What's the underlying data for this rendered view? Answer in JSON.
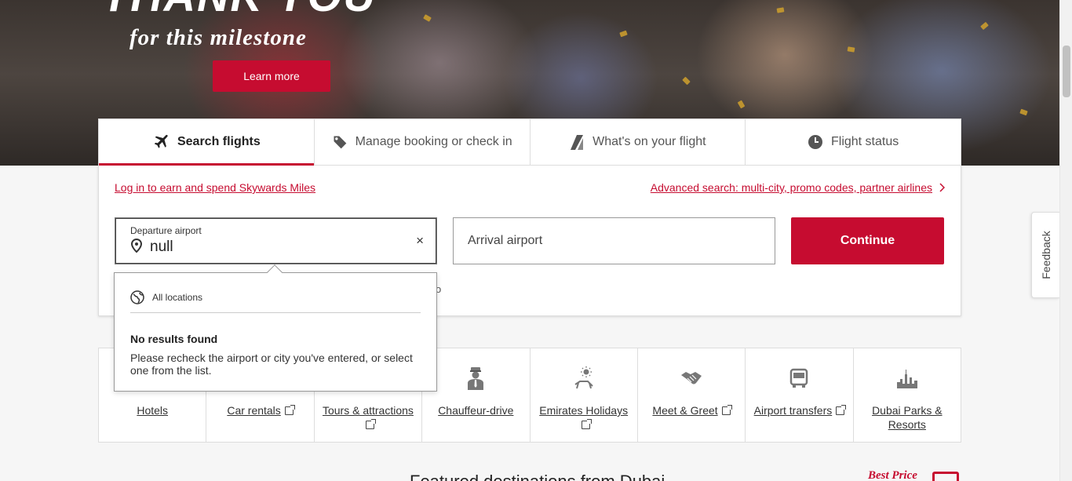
{
  "hero": {
    "title_partial": "THANK YOU",
    "subtitle": "for this milestone",
    "cta_label": "Learn more"
  },
  "tabs": [
    {
      "label": "Search flights",
      "icon": "plane-icon",
      "active": true
    },
    {
      "label": "Manage booking or check in",
      "icon": "tag-icon",
      "active": false
    },
    {
      "label": "What's on your flight",
      "icon": "tailfin-icon",
      "active": false
    },
    {
      "label": "Flight status",
      "icon": "clock-icon",
      "active": false
    }
  ],
  "links": {
    "login": "Log in to earn and spend Skywards Miles",
    "advanced": "Advanced search: multi-city, promo codes, partner airlines"
  },
  "search": {
    "departure_label": "Departure airport",
    "departure_value": "null",
    "clear_symbol": "×",
    "arrival_placeholder": "Arrival airport",
    "continue_label": "Continue"
  },
  "dropdown": {
    "all_locations": "All locations",
    "no_results_title": "No results found",
    "no_results_message": "Please recheck the airport or city you've entered, or select one from the list."
  },
  "services": [
    {
      "label": "Hotels",
      "icon": "hotel-icon",
      "external": false
    },
    {
      "label": "Car rentals",
      "icon": "car-icon",
      "external": true
    },
    {
      "label": "Tours & attractions",
      "icon": "tour-icon",
      "external": true
    },
    {
      "label": "Chauffeur-drive",
      "icon": "chauffeur-icon",
      "external": false
    },
    {
      "label": "Emirates Holidays",
      "icon": "holiday-icon",
      "external": true
    },
    {
      "label": "Meet & Greet",
      "icon": "handshake-icon",
      "external": true
    },
    {
      "label": "Airport transfers",
      "icon": "bus-icon",
      "external": true
    },
    {
      "label": "Dubai Parks & Resorts",
      "icon": "skyline-icon",
      "external": false
    }
  ],
  "bottom": {
    "heading_partial": "Featured destinations from Dubai",
    "best_price": "Best Price"
  },
  "feedback_label": "Feedback",
  "colors": {
    "brand_red": "#c60c30"
  }
}
